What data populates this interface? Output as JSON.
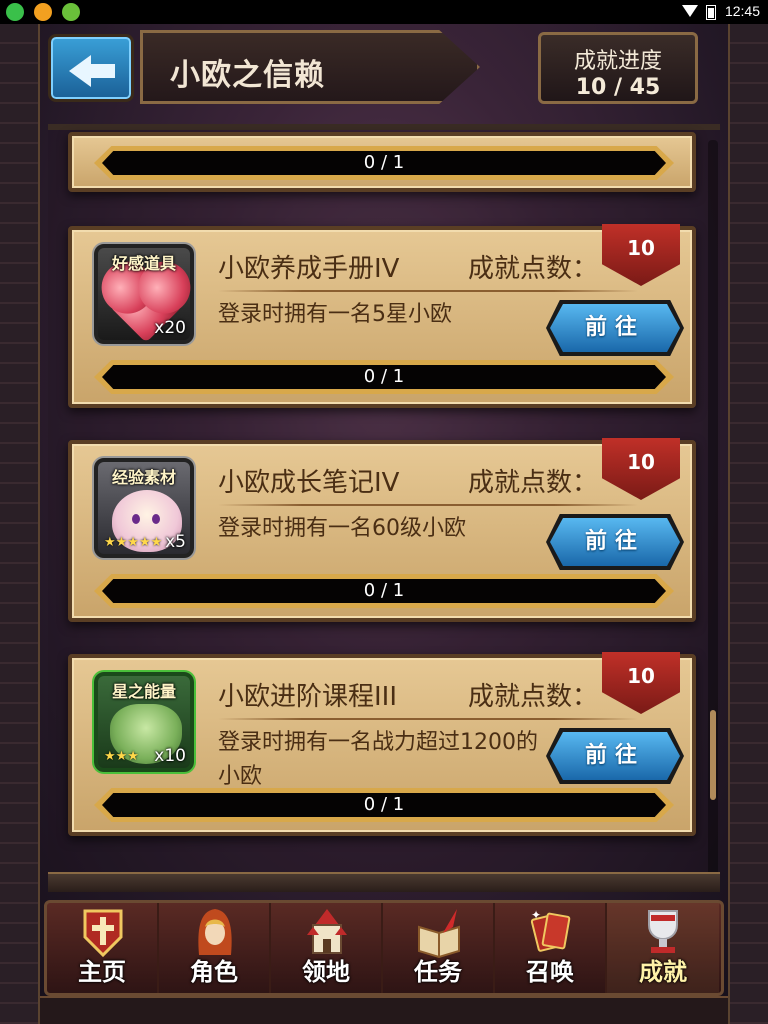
{
  "status_bar": {
    "time": "12:45"
  },
  "header": {
    "title": "小欧之信赖",
    "progress_label": "成就进度",
    "progress_value": "10 / 45"
  },
  "partial_card": {
    "progress": "0 / 1"
  },
  "cards": [
    {
      "icon_label": "好感道具",
      "icon_qty": "x20",
      "icon_stars": "",
      "title": "小欧养成手册IV",
      "points_label": "成就点数：",
      "points": "10",
      "desc": "登录时拥有一名5星小欧",
      "button": "前往",
      "progress": "0 / 1"
    },
    {
      "icon_label": "经验素材",
      "icon_qty": "x5",
      "icon_stars": "★★★★★",
      "title": "小欧成长笔记IV",
      "points_label": "成就点数：",
      "points": "10",
      "desc": "登录时拥有一名60级小欧",
      "button": "前往",
      "progress": "0 / 1"
    },
    {
      "icon_label": "星之能量",
      "icon_qty": "x10",
      "icon_stars": "★★★",
      "title": "小欧进阶课程III",
      "points_label": "成就点数：",
      "points": "10",
      "desc": "登录时拥有一名战力超过1200的小欧",
      "button": "前往",
      "progress": "0 / 1"
    }
  ],
  "nav": [
    {
      "label": "主页",
      "icon": "shield-cross-icon"
    },
    {
      "label": "角色",
      "icon": "hooded-character-icon"
    },
    {
      "label": "领地",
      "icon": "castle-icon"
    },
    {
      "label": "任务",
      "icon": "book-quill-icon"
    },
    {
      "label": "召唤",
      "icon": "cards-icon"
    },
    {
      "label": "成就",
      "icon": "trophy-icon"
    }
  ],
  "colors": {
    "card_bg": "#d8b67a",
    "button_blue": "#2a88cc",
    "badge_red": "#b02a22",
    "gold": "#d8a84a"
  }
}
